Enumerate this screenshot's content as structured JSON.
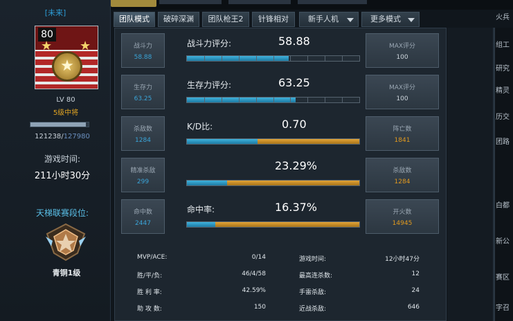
{
  "player": {
    "name": "",
    "title": "[未来]",
    "avatar_level": "80",
    "lv_label": "LV 80",
    "rank": "5级中将",
    "xp_current": "121238",
    "xp_sep": "/",
    "xp_max": "127980",
    "xp_fraction": 0.947,
    "playtime_label": "游戏时间:",
    "playtime_value": "211小时30分",
    "ladder_label": "天梯联赛段位:",
    "ladder_rank": "青铜1级"
  },
  "tabs": [
    {
      "label": "团队模式",
      "active": true
    },
    {
      "label": "破碎深渊"
    },
    {
      "label": "团队枪王2"
    },
    {
      "label": "针锋相对"
    },
    {
      "label": "新手人机",
      "dropdown": true
    },
    {
      "label": "更多模式",
      "dropdown": true
    }
  ],
  "rows": [
    {
      "left": {
        "label": "战斗力",
        "value": "58.88"
      },
      "title": "战斗力评分:",
      "value": "58.88",
      "bar": {
        "blue": 0.5888,
        "orange": 0.0
      },
      "right": {
        "label": "MAX评分",
        "value": "100",
        "orange": false
      }
    },
    {
      "left": {
        "label": "生存力",
        "value": "63.25"
      },
      "title": "生存力评分:",
      "value": "63.25",
      "bar": {
        "blue": 0.6325,
        "orange": 0.0
      },
      "right": {
        "label": "MAX评分",
        "value": "100",
        "orange": false
      }
    },
    {
      "left": {
        "label": "杀敌数",
        "value": "1284"
      },
      "title": "K/D比:",
      "value": "0.70",
      "bar": {
        "blue": 0.41,
        "orange": 0.59
      },
      "right": {
        "label": "阵亡数",
        "value": "1841",
        "orange": true
      }
    },
    {
      "left": {
        "label": "精准杀敌",
        "value": "299"
      },
      "title": "",
      "value": "23.29%",
      "bar": {
        "blue": 0.2329,
        "orange": 0.7671
      },
      "right": {
        "label": "杀敌数",
        "value": "1284",
        "orange": true
      }
    },
    {
      "left": {
        "label": "命中数",
        "value": "2447"
      },
      "title": "命中率:",
      "value": "16.37%",
      "bar": {
        "blue": 0.1637,
        "orange": 0.8363
      },
      "right": {
        "label": "开火数",
        "value": "14945",
        "orange": true
      }
    }
  ],
  "details": [
    {
      "k1": "MVP/ACE:",
      "v1": "0/14",
      "k2": "游戏时间:",
      "v2": "12小时47分"
    },
    {
      "k1": "胜/平/负:",
      "v1": "46/4/58",
      "k2": "最高连杀数:",
      "v2": "12"
    },
    {
      "k1": "胜 利 率:",
      "v1": "42.59%",
      "k2": "手雷杀敌:",
      "v2": "24"
    },
    {
      "k1": "助 攻 数:",
      "v1": "150",
      "k2": "近战杀敌:",
      "v2": "646"
    }
  ],
  "right_sidebar": [
    "火兵",
    "组工",
    "研究",
    "精灵",
    "历交",
    "团路",
    "白都",
    "新公",
    "赛区",
    "字召"
  ]
}
